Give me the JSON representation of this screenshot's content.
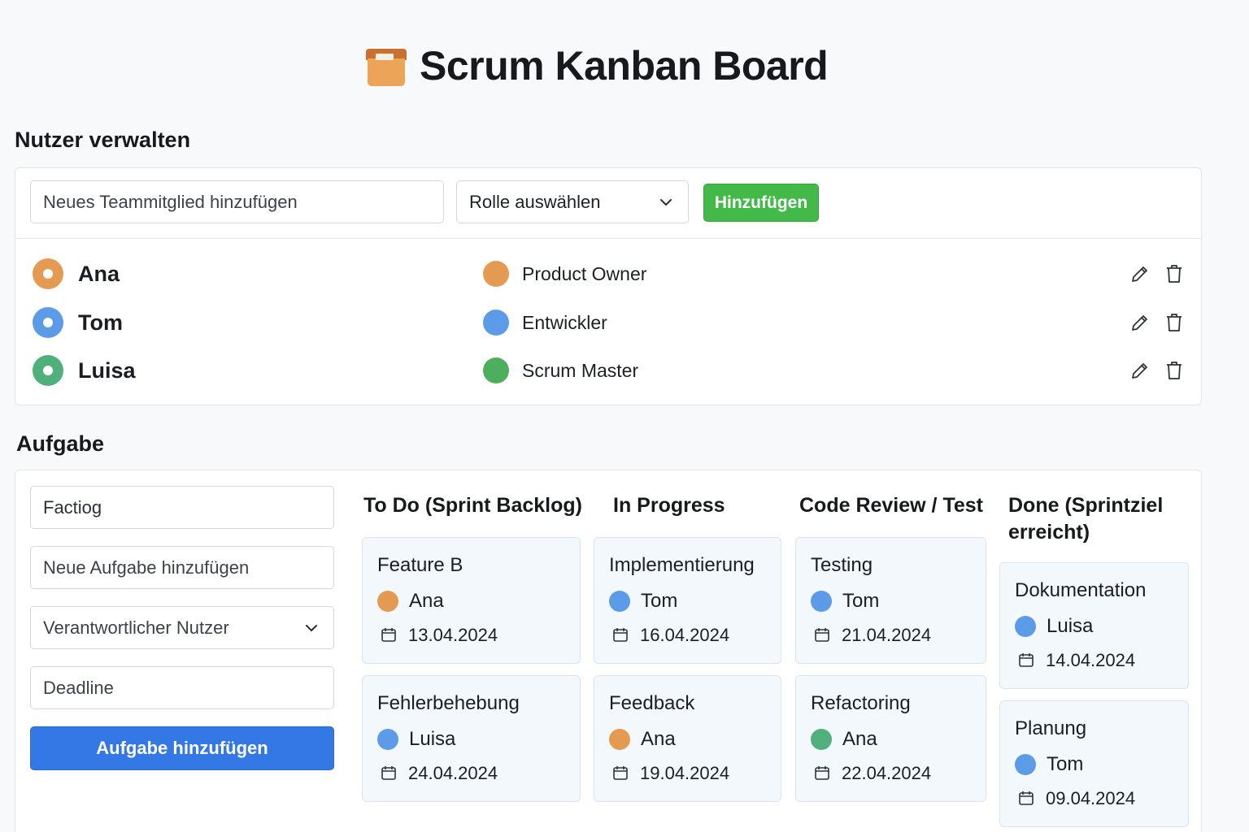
{
  "header": {
    "title": "Scrum Kanban Board",
    "icon": "box-icon"
  },
  "users_section": {
    "heading": "Nutzer verwalten",
    "name_placeholder": "Neues Teammitglied hinzufügen",
    "role_select": "Rolle auswählen",
    "add_button": "Hinzufügen",
    "users": [
      {
        "name": "Ana",
        "role": "Product Owner",
        "color": "#e59a52"
      },
      {
        "name": "Tom",
        "role": "Entwickler",
        "color": "#5b9be8"
      },
      {
        "name": "Luisa",
        "role": "Scrum Master",
        "color": "#4fae5e"
      }
    ]
  },
  "task_section": {
    "heading": "Aufgabe",
    "form": {
      "title_value": "Factiog",
      "description_placeholder": "Neue Aufgabe hinzufügen",
      "user_select": "Verantwortlicher Nutzer",
      "deadline_placeholder": "Deadline",
      "submit_button": "Aufgabe hinzufügen"
    },
    "columns": [
      {
        "title": "To Do (Sprint Backlog)",
        "cards": [
          {
            "title": "Feature B",
            "user": "Ana",
            "date": "13.04.2024",
            "color": "#e59a52"
          },
          {
            "title": "Fehlerbehebung",
            "user": "Luisa",
            "date": "24.04.2024",
            "color": "#5b9be8"
          }
        ]
      },
      {
        "title": "In Progress",
        "cards": [
          {
            "title": "Implementierung",
            "user": "Tom",
            "date": "16.04.2024",
            "color": "#5b9be8"
          },
          {
            "title": "Feedback",
            "user": "Ana",
            "date": "19.04.2024",
            "color": "#e59a52"
          }
        ]
      },
      {
        "title": "Code Review / Test",
        "cards": [
          {
            "title": "Testing",
            "user": "Tom",
            "date": "21.04.2024",
            "color": "#5b9be8"
          },
          {
            "title": "Refactoring",
            "user": "Ana",
            "date": "22.04.2024",
            "color": "#52b07d"
          }
        ]
      },
      {
        "title": "Done (Sprintziel erreicht)",
        "cards": [
          {
            "title": "Dokumentation",
            "user": "Luisa",
            "date": "14.04.2024",
            "color": "#5b9be8"
          },
          {
            "title": "Planung",
            "user": "Tom",
            "date": "09.04.2024",
            "color": "#5b9be8"
          }
        ]
      }
    ]
  }
}
